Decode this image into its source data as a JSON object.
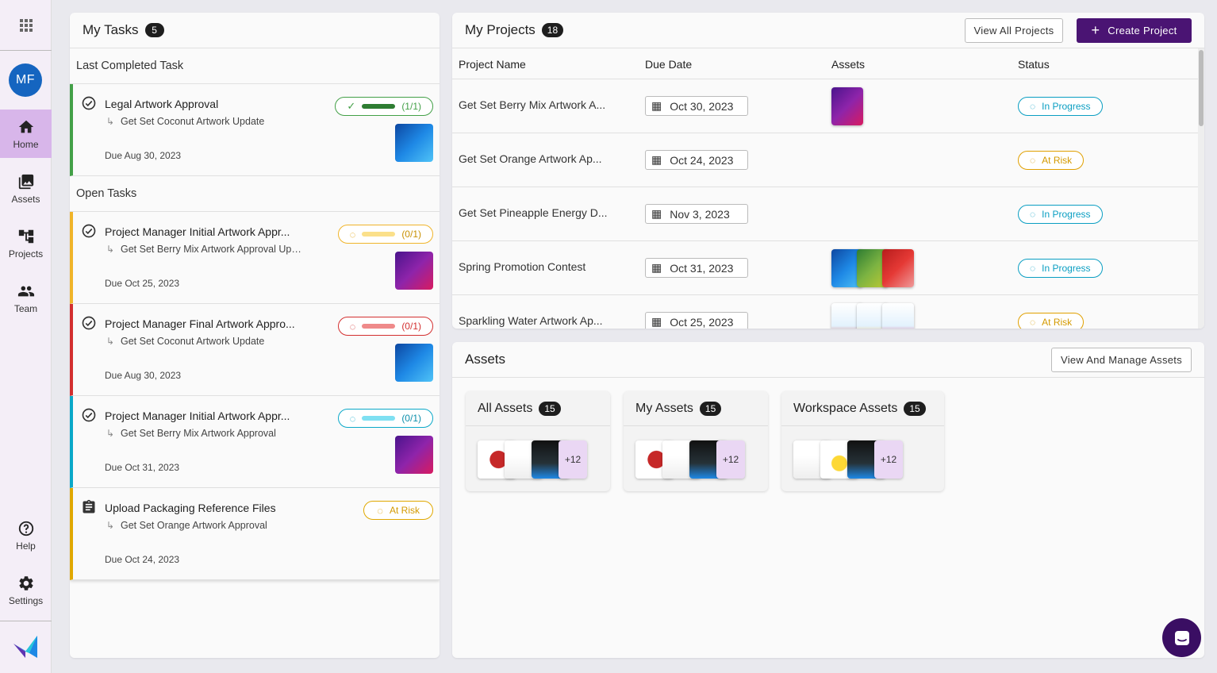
{
  "sidebar": {
    "avatar_initials": "MF",
    "items": [
      {
        "label": "Home",
        "icon": "home-icon",
        "active": true
      },
      {
        "label": "Assets",
        "icon": "image-library-icon",
        "active": false
      },
      {
        "label": "Projects",
        "icon": "hierarchy-icon",
        "active": false
      },
      {
        "label": "Team",
        "icon": "team-icon",
        "active": false
      }
    ],
    "bottom_items": [
      {
        "label": "Help",
        "icon": "help-icon"
      },
      {
        "label": "Settings",
        "icon": "gear-icon"
      }
    ]
  },
  "tasks": {
    "title": "My Tasks",
    "count": "5",
    "last_completed_label": "Last Completed Task",
    "open_label": "Open Tasks",
    "completed": {
      "title": "Legal Artwork Approval",
      "subtitle": "Get Set Coconut Artwork Update",
      "due": "Due Aug 30, 2023",
      "progress": "(1/1)",
      "progress_fraction": 1,
      "accent": "#43a047",
      "bar_color": "#2e7d32",
      "thumb": "blue"
    },
    "open": [
      {
        "title": "Project Manager Initial Artwork Appr...",
        "subtitle": "Get Set Berry Mix Artwork Approval Upd...",
        "due": "Due Oct 25, 2023",
        "progress": "(0/1)",
        "progress_fraction": 0,
        "accent": "#f0b429",
        "bar_color": "#fbe08a",
        "thumb": "purple"
      },
      {
        "title": "Project Manager Final Artwork Appro...",
        "subtitle": "Get Set Coconut Artwork Update",
        "due": "Due Aug 30, 2023",
        "progress": "(0/1)",
        "progress_fraction": 0,
        "accent": "#d32f2f",
        "bar_color": "#ef8a8a",
        "thumb": "blue"
      },
      {
        "title": "Project Manager Initial Artwork Appr...",
        "subtitle": "Get Set Berry Mix Artwork Approval",
        "due": "Due Oct 31, 2023",
        "progress": "(0/1)",
        "progress_fraction": 0,
        "accent": "#0aa8c8",
        "bar_color": "#7fe0f2",
        "thumb": "purple"
      },
      {
        "title": "Upload Packaging Reference Files",
        "subtitle": "Get Set Orange Artwork Approval",
        "due": "Due Oct 24, 2023",
        "status": "At Risk",
        "accent": "#e0a800",
        "thumb": "none"
      }
    ]
  },
  "projects": {
    "title": "My Projects",
    "count": "18",
    "view_all_label": "View All Projects",
    "create_label": "Create Project",
    "columns": [
      "Project Name",
      "Due Date",
      "Assets",
      "Status"
    ],
    "rows": [
      {
        "name": "Get Set Berry Mix Artwork A...",
        "due": "Oct 30, 2023",
        "assets": [
          "purple"
        ],
        "status": "In Progress"
      },
      {
        "name": "Get Set Orange Artwork Ap...",
        "due": "Oct 24, 2023",
        "assets": [],
        "status": "At Risk"
      },
      {
        "name": "Get Set Pineapple Energy D...",
        "due": "Nov 3, 2023",
        "assets": [],
        "status": "In Progress"
      },
      {
        "name": "Spring Promotion Contest",
        "due": "Oct 31, 2023",
        "assets": [
          "blue",
          "green",
          "red"
        ],
        "status": "In Progress"
      },
      {
        "name": "Sparkling Water Artwork Ap...",
        "due": "Oct 25, 2023",
        "assets": [
          "white",
          "white",
          "white"
        ],
        "status": "At Risk"
      }
    ]
  },
  "assets": {
    "title": "Assets",
    "manage_label": "View And Manage Assets",
    "cards": [
      {
        "title": "All Assets",
        "count": "15",
        "more": "+12"
      },
      {
        "title": "My Assets",
        "count": "15",
        "more": "+12"
      },
      {
        "title": "Workspace Assets",
        "count": "15",
        "more": "+12"
      }
    ]
  },
  "colors": {
    "in_progress": "#0a9ec2",
    "at_risk": "#e0a000",
    "primary": "#4a1473",
    "nav_active": "#d8b6ea"
  }
}
